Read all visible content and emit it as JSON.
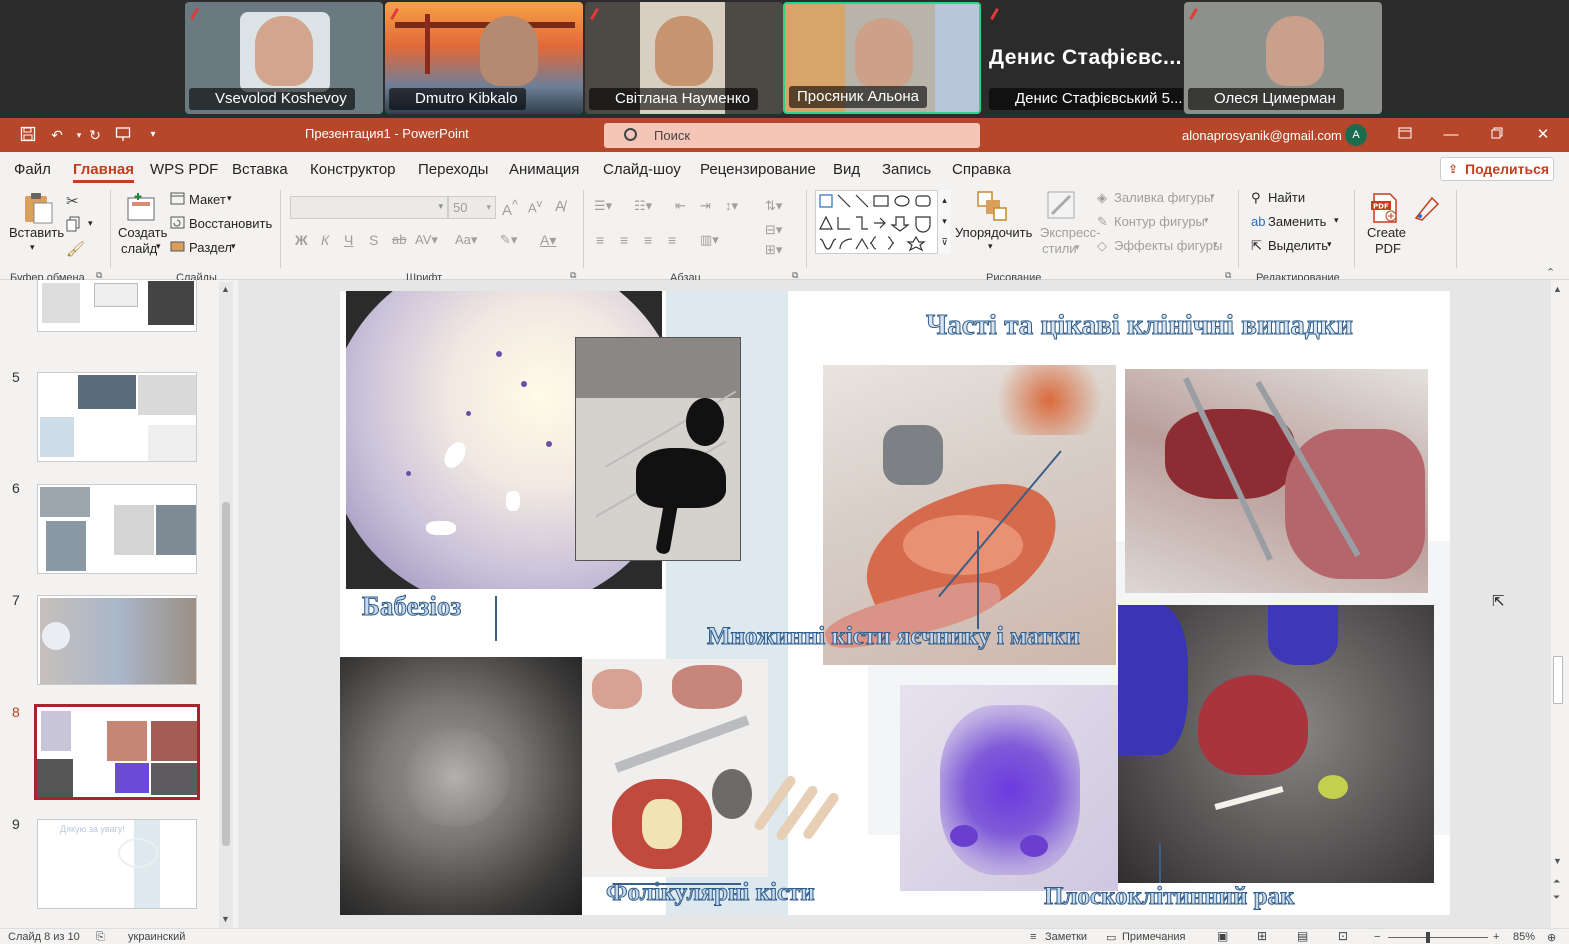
{
  "meeting": {
    "participants": [
      {
        "name": "Vsevolod Koshevoy"
      },
      {
        "name": "Dmutro Kibkalo"
      },
      {
        "name": "Світлана Науменко"
      },
      {
        "name": "Просяник Альона",
        "active": true
      },
      {
        "name": "Денис Стафієвський 5...",
        "banner": "Денис Стафієвс..."
      },
      {
        "name": "Олеся Цимерман"
      }
    ]
  },
  "titlebar": {
    "document": "Презентация1  -  PowerPoint",
    "search_placeholder": "Поиск",
    "account": "alonaprosyanik@gmail.com",
    "avatar": "A"
  },
  "menu": {
    "tabs": [
      "Файл",
      "Главная",
      "WPS PDF",
      "Вставка",
      "Конструктор",
      "Переходы",
      "Анимация",
      "Слайд-шоу",
      "Рецензирование",
      "Вид",
      "Запись",
      "Справка"
    ],
    "active": "Главная",
    "share": "Поделиться"
  },
  "ribbon": {
    "paste": "Вставить",
    "new_slide_1": "Создать",
    "new_slide_2": "слайд",
    "layout": "Макет",
    "reset": "Восстановить",
    "section": "Раздел",
    "font_size": "50",
    "arrange": "Упорядочить",
    "quick_styles_1": "Экспресс-",
    "quick_styles_2": "стили",
    "shape_fill": "Заливка фигуры",
    "shape_outline": "Контур фигуры",
    "shape_effects": "Эффекты фигуры",
    "find": "Найти",
    "replace": "Заменить",
    "select": "Выделить",
    "create_pdf_1": "Create",
    "create_pdf_2": "PDF",
    "groups": {
      "clipboard": "Буфер обмена",
      "slides": "Слайды",
      "font": "Шрифт",
      "paragraph": "Абзац",
      "drawing": "Рисование",
      "editing": "Редактирование"
    }
  },
  "thumbnails": [
    {
      "number": "5"
    },
    {
      "number": "6"
    },
    {
      "number": "7"
    },
    {
      "number": "8",
      "selected": true
    },
    {
      "number": "9",
      "text": "Дякую за увагу!"
    }
  ],
  "slide": {
    "title": "Часті та цікаві клінічні випадки",
    "captions": {
      "babesiosis": "Бабезіоз",
      "ovary_cysts": "Множинні кісти яєчнику і матки",
      "follicular": "Фолікулярні кісти",
      "carcinoma": "Плоскоклітинний рак"
    }
  },
  "statusbar": {
    "slide_of": "Слайд 8 из 10",
    "language": "украинский",
    "notes": "Заметки",
    "comments": "Примечания",
    "zoom": "85%"
  },
  "colors": {
    "accent": "#b7472a",
    "active_tab": "#c43e1c",
    "thumb_selected": "#a4262c"
  }
}
